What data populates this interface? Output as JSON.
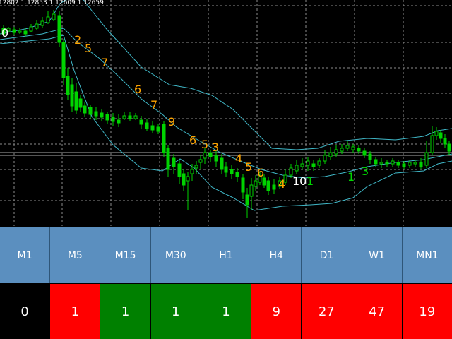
{
  "chart": {
    "ohlc_text": "12802 1.12853 1.12609 1.12659",
    "counters": [
      {
        "text": "0",
        "color": "white"
      },
      {
        "text": "2",
        "color": "gold"
      },
      {
        "text": "5",
        "color": "gold"
      },
      {
        "text": "7",
        "color": "gold"
      },
      {
        "text": "6",
        "color": "gold"
      },
      {
        "text": "7",
        "color": "gold"
      },
      {
        "text": "9",
        "color": "gold"
      },
      {
        "text": "6",
        "color": "gold"
      },
      {
        "text": "5",
        "color": "gold"
      },
      {
        "text": "3",
        "color": "gold"
      },
      {
        "text": "4",
        "color": "gold"
      },
      {
        "text": "5",
        "color": "gold"
      },
      {
        "text": "6",
        "color": "gold"
      },
      {
        "text": "4",
        "color": "gold"
      },
      {
        "text": "10",
        "color": "white"
      },
      {
        "text": "1",
        "color": "green"
      },
      {
        "text": "1",
        "color": "green"
      },
      {
        "text": "3",
        "color": "green"
      }
    ]
  },
  "timeframes": [
    {
      "label": "M1",
      "value": "0",
      "status": "neutral"
    },
    {
      "label": "M5",
      "value": "1",
      "status": "down"
    },
    {
      "label": "M15",
      "value": "1",
      "status": "up"
    },
    {
      "label": "M30",
      "value": "1",
      "status": "up"
    },
    {
      "label": "H1",
      "value": "1",
      "status": "up"
    },
    {
      "label": "H4",
      "value": "9",
      "status": "down"
    },
    {
      "label": "D1",
      "value": "27",
      "status": "down"
    },
    {
      "label": "W1",
      "value": "47",
      "status": "down"
    },
    {
      "label": "MN1",
      "value": "19",
      "status": "down"
    }
  ],
  "colors": {
    "neutral": "#000000",
    "down": "#ff0000",
    "up": "#008000",
    "header": "#5b8fbf",
    "bands": "#40b8c8",
    "candle": "#00d400",
    "grid": "#8c8c8c"
  }
}
